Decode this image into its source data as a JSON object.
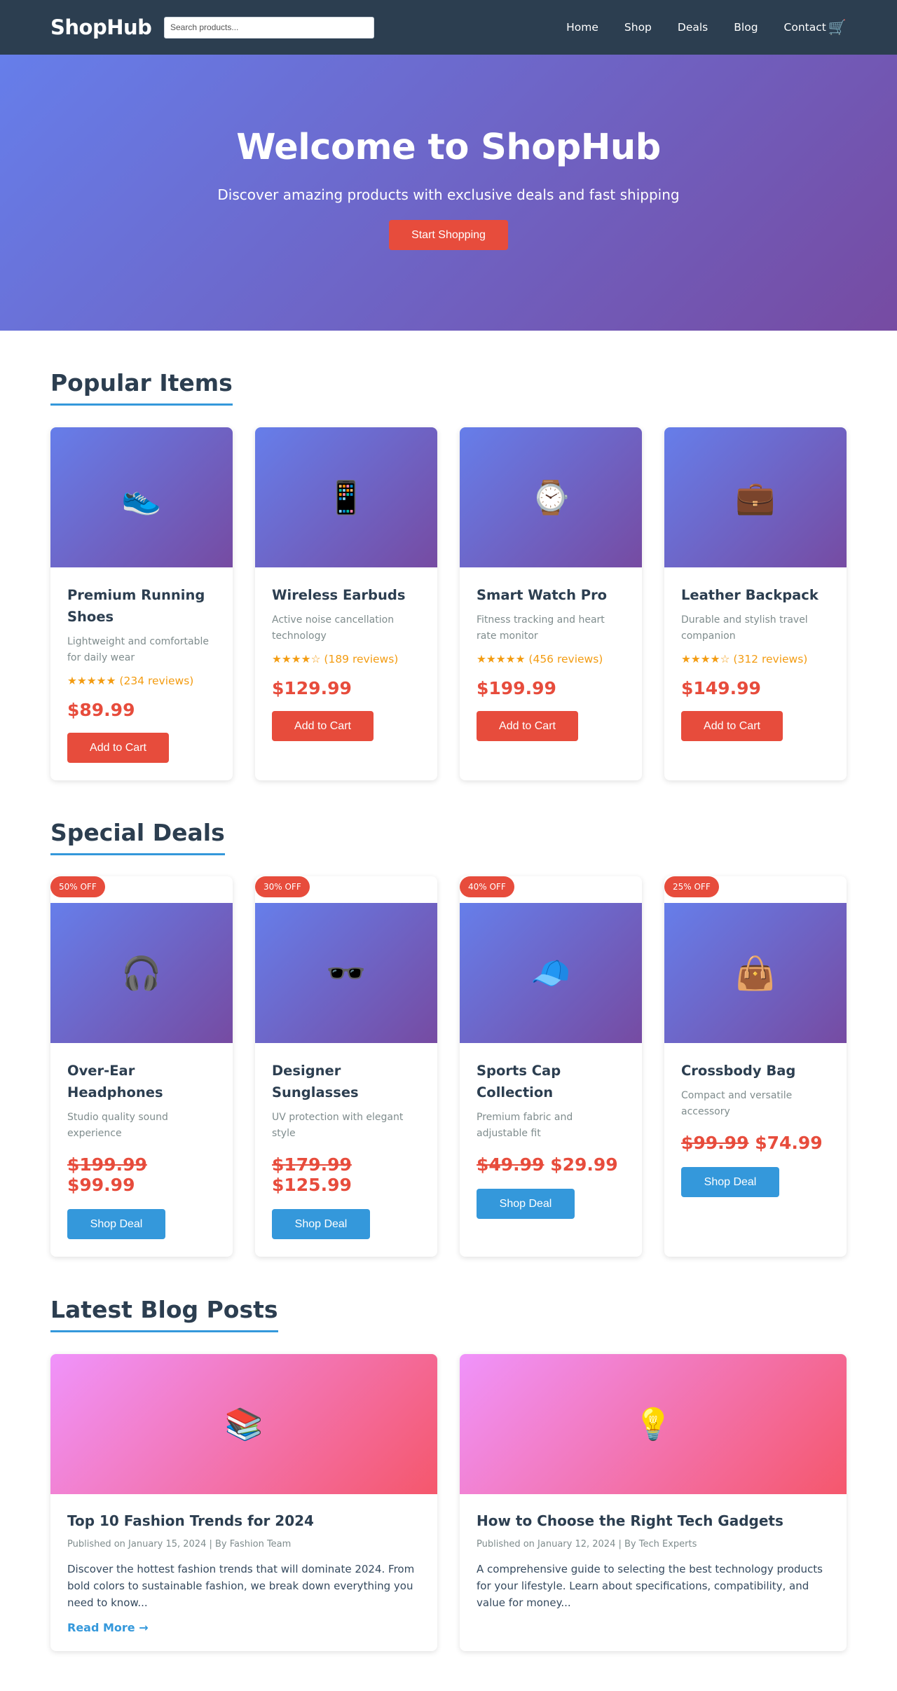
{
  "header": {
    "logo": "ShopHub",
    "search_placeholder": "Search products...",
    "nav": [
      "Home",
      "Shop",
      "Deals",
      "Blog",
      "Contact"
    ],
    "cart_icon": "🛒"
  },
  "hero": {
    "title": "Welcome to ShopHub",
    "subtitle": "Discover amazing products with exclusive deals and fast shipping",
    "cta": "Start Shopping"
  },
  "popular": {
    "title": "Popular Items",
    "items": [
      {
        "icon": "👟",
        "name": "Premium Running Shoes",
        "desc": "Lightweight and comfortable for daily wear",
        "rating": "★★★★★ (234 reviews)",
        "price": "$89.99",
        "button": "Add to Cart"
      },
      {
        "icon": "📱",
        "name": "Wireless Earbuds",
        "desc": "Active noise cancellation technology",
        "rating": "★★★★☆ (189 reviews)",
        "price": "$129.99",
        "button": "Add to Cart"
      },
      {
        "icon": "⌚",
        "name": "Smart Watch Pro",
        "desc": "Fitness tracking and heart rate monitor",
        "rating": "★★★★★ (456 reviews)",
        "price": "$199.99",
        "button": "Add to Cart"
      },
      {
        "icon": "💼",
        "name": "Leather Backpack",
        "desc": "Durable and stylish travel companion",
        "rating": "★★★★☆ (312 reviews)",
        "price": "$149.99",
        "button": "Add to Cart"
      }
    ]
  },
  "deals": {
    "title": "Special Deals",
    "items": [
      {
        "badge": "50% OFF",
        "icon": "🎧",
        "name": "Over-Ear Headphones",
        "desc": "Studio quality sound experience",
        "old_price": "$199.99",
        "price": "$99.99",
        "button": "Shop Deal"
      },
      {
        "badge": "30% OFF",
        "icon": "🕶️",
        "name": "Designer Sunglasses",
        "desc": "UV protection with elegant style",
        "old_price": "$179.99",
        "price": "$125.99",
        "button": "Shop Deal"
      },
      {
        "badge": "40% OFF",
        "icon": "🧢",
        "name": "Sports Cap Collection",
        "desc": "Premium fabric and adjustable fit",
        "old_price": "$49.99",
        "price": "$29.99",
        "button": "Shop Deal"
      },
      {
        "badge": "25% OFF",
        "icon": "👜",
        "name": "Crossbody Bag",
        "desc": "Compact and versatile accessory",
        "old_price": "$99.99",
        "price": "$74.99",
        "button": "Shop Deal"
      }
    ]
  },
  "blog": {
    "title": "Latest Blog Posts",
    "posts": [
      {
        "icon": "📚",
        "title": "Top 10 Fashion Trends for 2024",
        "meta": "Published on January 15, 2024 | By Fashion Team",
        "excerpt": "Discover the hottest fashion trends that will dominate 2024. From bold colors to sustainable fashion, we break down everything you need to know...",
        "read_more": "Read More →"
      },
      {
        "icon": "💡",
        "title": "How to Choose the Right Tech Gadgets",
        "meta": "Published on January 12, 2024 | By Tech Experts",
        "excerpt": "A comprehensive guide to selecting the best technology products for your lifestyle. Learn about specifications, compatibility, and value for money...",
        "read_more": ""
      }
    ]
  },
  "colors": {
    "header_bg": "#2c3e50",
    "accent_red": "#e74c3c",
    "accent_blue": "#3498db",
    "rating": "#f39c12"
  }
}
